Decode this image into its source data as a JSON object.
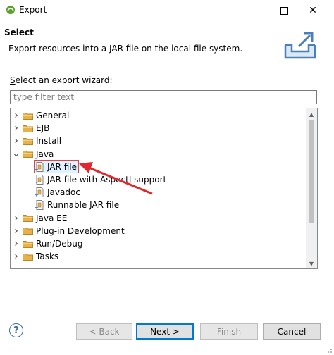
{
  "window": {
    "title": "Export",
    "minimize_icon": "minimize-icon",
    "maximize_icon": "maximize-icon",
    "close_icon": "close-icon",
    "close_glyph": "✕"
  },
  "header": {
    "title": "Select",
    "description": "Export resources into a JAR file on the local file system."
  },
  "wizard": {
    "label_prefix": "S",
    "label_rest": "elect an export wizard:",
    "filter_placeholder": "type filter text"
  },
  "tree": {
    "rows": [
      {
        "label": "General",
        "type": "folder",
        "expanded": false
      },
      {
        "label": "EJB",
        "type": "folder",
        "expanded": false
      },
      {
        "label": "Install",
        "type": "folder",
        "expanded": false
      },
      {
        "label": "Java",
        "type": "folder",
        "expanded": true
      },
      {
        "label": "JAR file",
        "type": "leaf",
        "selected": true
      },
      {
        "label": "JAR file with AspectJ support",
        "type": "leaf"
      },
      {
        "label": "Javadoc",
        "type": "leaf"
      },
      {
        "label": "Runnable JAR file",
        "type": "leaf"
      },
      {
        "label": "Java EE",
        "type": "folder",
        "expanded": false
      },
      {
        "label": "Plug-in Development",
        "type": "folder",
        "expanded": false
      },
      {
        "label": "Run/Debug",
        "type": "folder",
        "expanded": false
      },
      {
        "label": "Tasks",
        "type": "folder",
        "expanded": false
      }
    ]
  },
  "buttons": {
    "back": "< Back",
    "next": "Next >",
    "finish": "Finish",
    "cancel": "Cancel",
    "help": "?"
  },
  "colors": {
    "annotation_red": "#e0282e",
    "folder": "#e8b24a",
    "primary_border": "#0078d7"
  }
}
